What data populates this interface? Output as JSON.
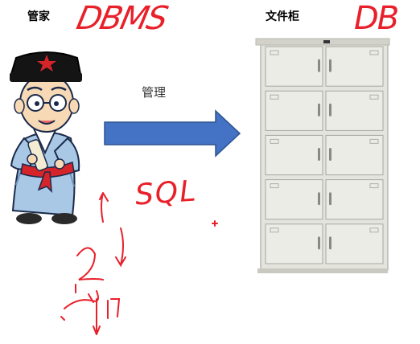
{
  "labels": {
    "steward": "管家",
    "file_cabinet": "文件柜",
    "manage": "管理"
  },
  "handwriting": {
    "dbms": "DBMS",
    "db": "DB",
    "sql": "SQL"
  },
  "cabinet": {
    "rows": 5
  },
  "colors": {
    "arrow_fill": "#4472c4",
    "annotation_red": "#e8202a",
    "cabinet_body": "#e4e4de"
  }
}
